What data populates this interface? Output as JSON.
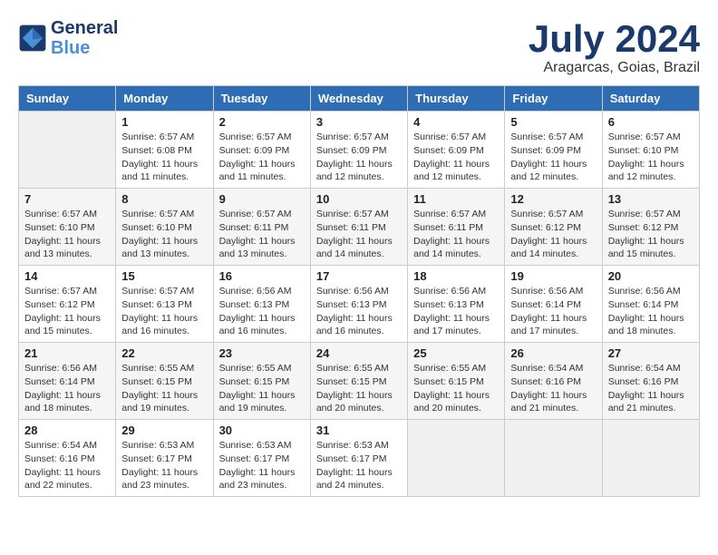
{
  "header": {
    "logo_line1": "General",
    "logo_line2": "Blue",
    "month_title": "July 2024",
    "subtitle": "Aragarcas, Goias, Brazil"
  },
  "weekdays": [
    "Sunday",
    "Monday",
    "Tuesday",
    "Wednesday",
    "Thursday",
    "Friday",
    "Saturday"
  ],
  "weeks": [
    [
      {
        "day": "",
        "empty": true
      },
      {
        "day": "1",
        "sunrise": "6:57 AM",
        "sunset": "6:08 PM",
        "daylight": "11 hours and 11 minutes."
      },
      {
        "day": "2",
        "sunrise": "6:57 AM",
        "sunset": "6:09 PM",
        "daylight": "11 hours and 11 minutes."
      },
      {
        "day": "3",
        "sunrise": "6:57 AM",
        "sunset": "6:09 PM",
        "daylight": "11 hours and 12 minutes."
      },
      {
        "day": "4",
        "sunrise": "6:57 AM",
        "sunset": "6:09 PM",
        "daylight": "11 hours and 12 minutes."
      },
      {
        "day": "5",
        "sunrise": "6:57 AM",
        "sunset": "6:09 PM",
        "daylight": "11 hours and 12 minutes."
      },
      {
        "day": "6",
        "sunrise": "6:57 AM",
        "sunset": "6:10 PM",
        "daylight": "11 hours and 12 minutes."
      }
    ],
    [
      {
        "day": "7",
        "sunrise": "6:57 AM",
        "sunset": "6:10 PM",
        "daylight": "11 hours and 13 minutes."
      },
      {
        "day": "8",
        "sunrise": "6:57 AM",
        "sunset": "6:10 PM",
        "daylight": "11 hours and 13 minutes."
      },
      {
        "day": "9",
        "sunrise": "6:57 AM",
        "sunset": "6:11 PM",
        "daylight": "11 hours and 13 minutes."
      },
      {
        "day": "10",
        "sunrise": "6:57 AM",
        "sunset": "6:11 PM",
        "daylight": "11 hours and 14 minutes."
      },
      {
        "day": "11",
        "sunrise": "6:57 AM",
        "sunset": "6:11 PM",
        "daylight": "11 hours and 14 minutes."
      },
      {
        "day": "12",
        "sunrise": "6:57 AM",
        "sunset": "6:12 PM",
        "daylight": "11 hours and 14 minutes."
      },
      {
        "day": "13",
        "sunrise": "6:57 AM",
        "sunset": "6:12 PM",
        "daylight": "11 hours and 15 minutes."
      }
    ],
    [
      {
        "day": "14",
        "sunrise": "6:57 AM",
        "sunset": "6:12 PM",
        "daylight": "11 hours and 15 minutes."
      },
      {
        "day": "15",
        "sunrise": "6:57 AM",
        "sunset": "6:13 PM",
        "daylight": "11 hours and 16 minutes."
      },
      {
        "day": "16",
        "sunrise": "6:56 AM",
        "sunset": "6:13 PM",
        "daylight": "11 hours and 16 minutes."
      },
      {
        "day": "17",
        "sunrise": "6:56 AM",
        "sunset": "6:13 PM",
        "daylight": "11 hours and 16 minutes."
      },
      {
        "day": "18",
        "sunrise": "6:56 AM",
        "sunset": "6:13 PM",
        "daylight": "11 hours and 17 minutes."
      },
      {
        "day": "19",
        "sunrise": "6:56 AM",
        "sunset": "6:14 PM",
        "daylight": "11 hours and 17 minutes."
      },
      {
        "day": "20",
        "sunrise": "6:56 AM",
        "sunset": "6:14 PM",
        "daylight": "11 hours and 18 minutes."
      }
    ],
    [
      {
        "day": "21",
        "sunrise": "6:56 AM",
        "sunset": "6:14 PM",
        "daylight": "11 hours and 18 minutes."
      },
      {
        "day": "22",
        "sunrise": "6:55 AM",
        "sunset": "6:15 PM",
        "daylight": "11 hours and 19 minutes."
      },
      {
        "day": "23",
        "sunrise": "6:55 AM",
        "sunset": "6:15 PM",
        "daylight": "11 hours and 19 minutes."
      },
      {
        "day": "24",
        "sunrise": "6:55 AM",
        "sunset": "6:15 PM",
        "daylight": "11 hours and 20 minutes."
      },
      {
        "day": "25",
        "sunrise": "6:55 AM",
        "sunset": "6:15 PM",
        "daylight": "11 hours and 20 minutes."
      },
      {
        "day": "26",
        "sunrise": "6:54 AM",
        "sunset": "6:16 PM",
        "daylight": "11 hours and 21 minutes."
      },
      {
        "day": "27",
        "sunrise": "6:54 AM",
        "sunset": "6:16 PM",
        "daylight": "11 hours and 21 minutes."
      }
    ],
    [
      {
        "day": "28",
        "sunrise": "6:54 AM",
        "sunset": "6:16 PM",
        "daylight": "11 hours and 22 minutes."
      },
      {
        "day": "29",
        "sunrise": "6:53 AM",
        "sunset": "6:17 PM",
        "daylight": "11 hours and 23 minutes."
      },
      {
        "day": "30",
        "sunrise": "6:53 AM",
        "sunset": "6:17 PM",
        "daylight": "11 hours and 23 minutes."
      },
      {
        "day": "31",
        "sunrise": "6:53 AM",
        "sunset": "6:17 PM",
        "daylight": "11 hours and 24 minutes."
      },
      {
        "day": "",
        "empty": true
      },
      {
        "day": "",
        "empty": true
      },
      {
        "day": "",
        "empty": true
      }
    ]
  ]
}
